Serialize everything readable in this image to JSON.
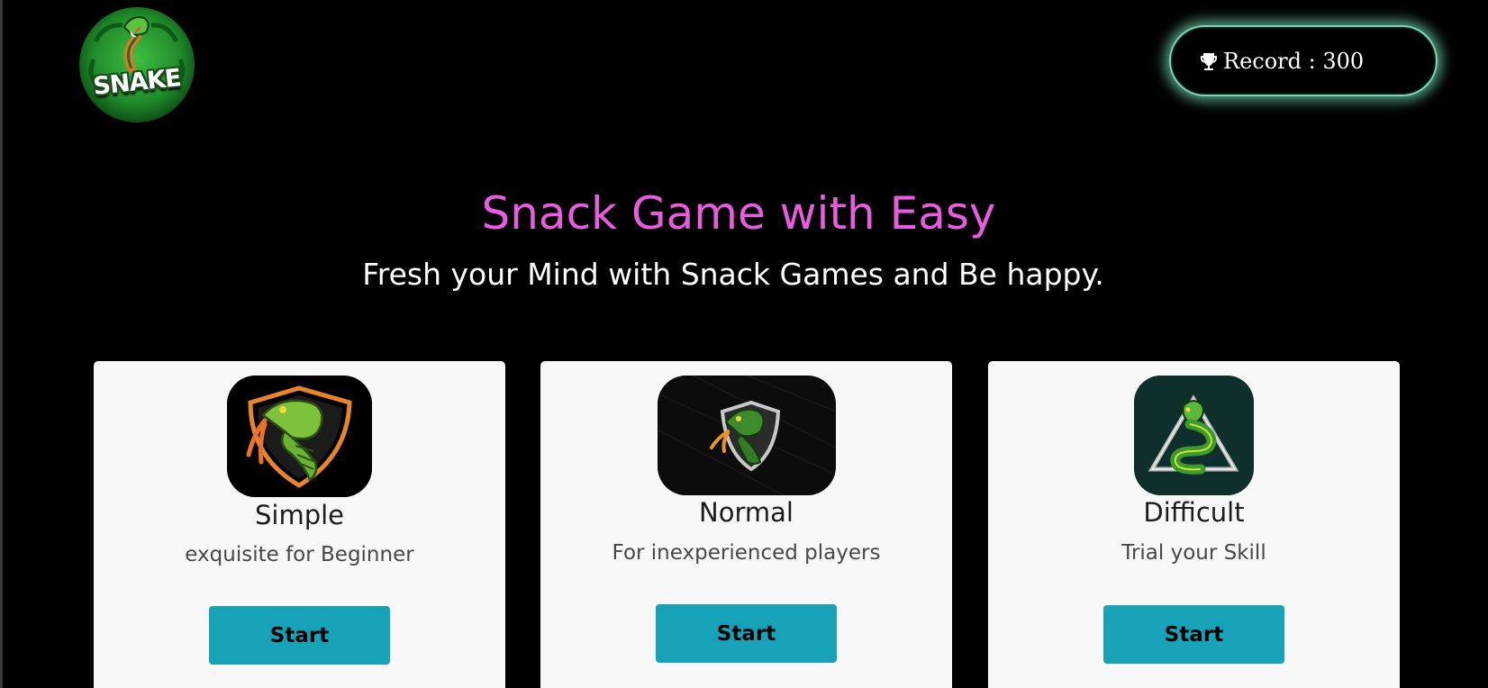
{
  "header": {
    "logo_text": "SNAKE",
    "logo_icon": "snake-logo-icon",
    "record_icon": "trophy-icon",
    "record_text": "Record : 300"
  },
  "hero": {
    "title": "Snack Game with Easy",
    "subtitle": "Fresh your Mind with Snack Games and Be happy."
  },
  "levels": [
    {
      "icon": "snake-shield-orange-icon",
      "title": "Simple",
      "description": "exquisite for Beginner",
      "button_label": "Start"
    },
    {
      "icon": "snake-shield-silver-icon",
      "title": "Normal",
      "description": "For inexperienced players",
      "button_label": "Start"
    },
    {
      "icon": "snake-triangle-icon",
      "title": "Difficult",
      "description": "Trial your Skill",
      "button_label": "Start"
    }
  ],
  "colors": {
    "background": "#000000",
    "title_accent": "#e85ce0",
    "record_glow": "#7fd6b5",
    "button": "#17a2b8",
    "card": "#f8f8f8"
  }
}
